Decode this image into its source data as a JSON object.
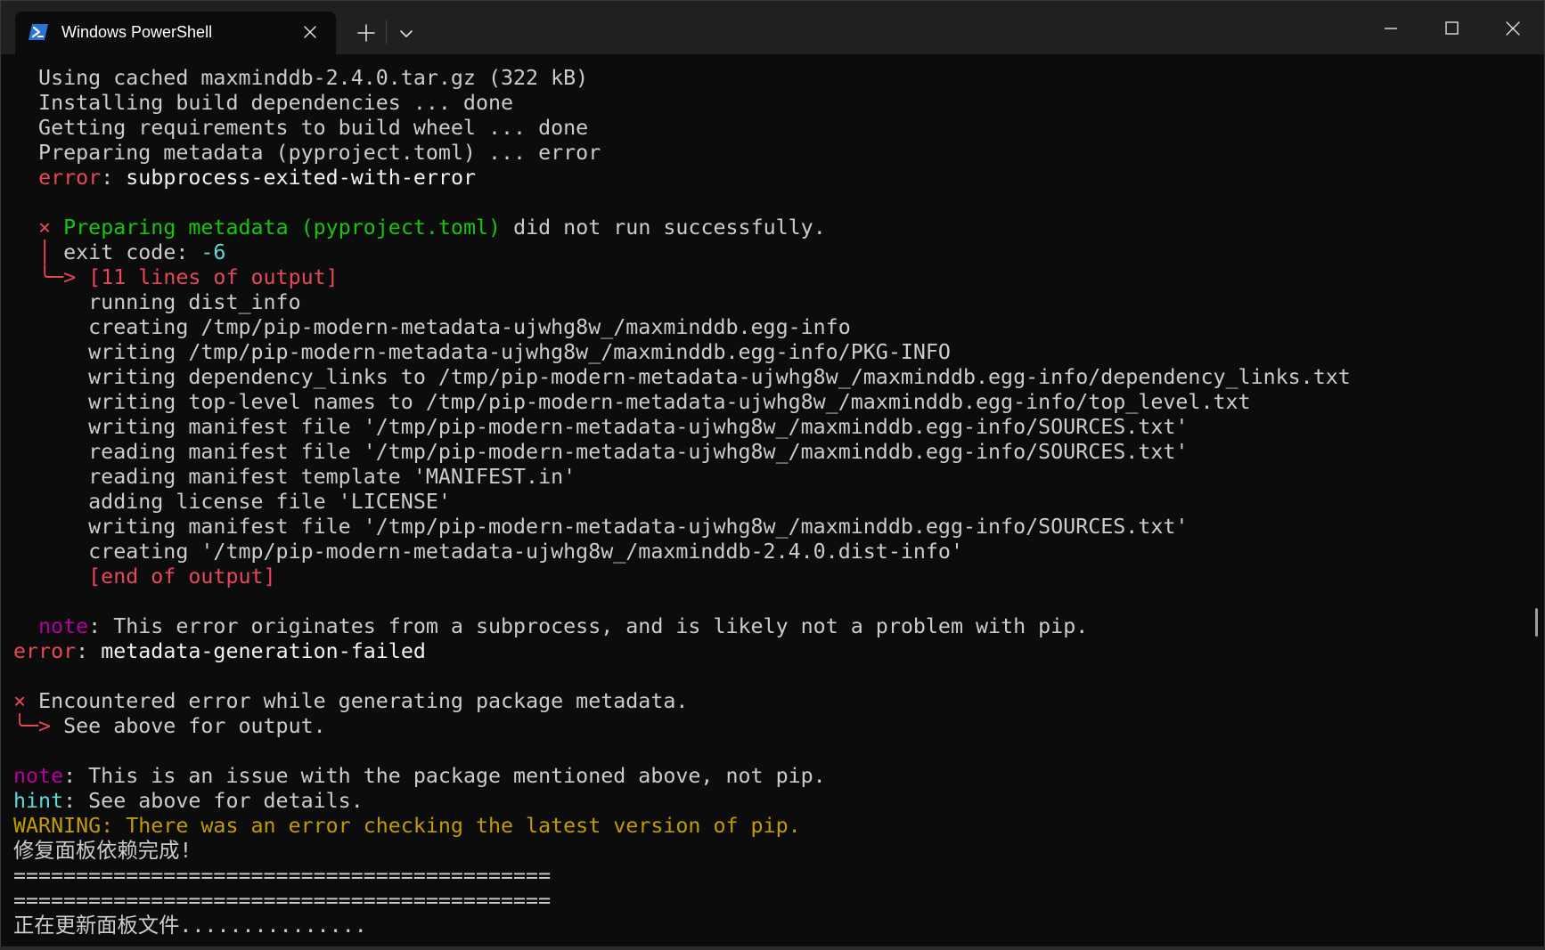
{
  "tab": {
    "title": "Windows PowerShell",
    "icon": "powershell-icon",
    "close_glyph": "✕"
  },
  "toolbar": {
    "new_tab_glyph": "+",
    "dropdown_glyph": "⌄"
  },
  "window_controls": {
    "minimize_glyph": "—",
    "maximize_glyph": "☐",
    "close_glyph": "✕"
  },
  "colors": {
    "background": "#0c0c0c",
    "titlebar": "#202020",
    "foreground": "#cccccc",
    "red": "#e74856",
    "green": "#16c60c",
    "cyan": "#61d6d6",
    "magenta": "#b4009e",
    "yellow": "#c19c00"
  },
  "terminal": {
    "lines": [
      [
        {
          "t": "  Using cached maxminddb-2.4.0.tar.gz (322 kB)"
        }
      ],
      [
        {
          "t": "  Installing build dependencies ... done"
        }
      ],
      [
        {
          "t": "  Getting requirements to build wheel ... done"
        }
      ],
      [
        {
          "t": "  Preparing metadata (pyproject.toml) ... error"
        }
      ],
      [
        {
          "t": "  "
        },
        {
          "t": "error",
          "c": "red"
        },
        {
          "t": ": "
        },
        {
          "t": "subprocess-exited-with-error",
          "c": "white"
        }
      ],
      [
        {
          "t": ""
        }
      ],
      [
        {
          "t": "  "
        },
        {
          "t": "×",
          "c": "red"
        },
        {
          "t": " "
        },
        {
          "t": "Preparing metadata (pyproject.toml)",
          "c": "green"
        },
        {
          "t": " did not run successfully."
        }
      ],
      [
        {
          "t": "  "
        },
        {
          "t": "│",
          "c": "red"
        },
        {
          "t": " exit code: "
        },
        {
          "t": "-6",
          "c": "cyan"
        }
      ],
      [
        {
          "t": "  "
        },
        {
          "t": "╰─>",
          "c": "red"
        },
        {
          "t": " "
        },
        {
          "t": "[11 lines of output]",
          "c": "red"
        }
      ],
      [
        {
          "t": "      running dist_info"
        }
      ],
      [
        {
          "t": "      creating /tmp/pip-modern-metadata-ujwhg8w_/maxminddb.egg-info"
        }
      ],
      [
        {
          "t": "      writing /tmp/pip-modern-metadata-ujwhg8w_/maxminddb.egg-info/PKG-INFO"
        }
      ],
      [
        {
          "t": "      writing dependency_links to /tmp/pip-modern-metadata-ujwhg8w_/maxminddb.egg-info/dependency_links.txt"
        }
      ],
      [
        {
          "t": "      writing top-level names to /tmp/pip-modern-metadata-ujwhg8w_/maxminddb.egg-info/top_level.txt"
        }
      ],
      [
        {
          "t": "      writing manifest file '/tmp/pip-modern-metadata-ujwhg8w_/maxminddb.egg-info/SOURCES.txt'"
        }
      ],
      [
        {
          "t": "      reading manifest file '/tmp/pip-modern-metadata-ujwhg8w_/maxminddb.egg-info/SOURCES.txt'"
        }
      ],
      [
        {
          "t": "      reading manifest template 'MANIFEST.in'"
        }
      ],
      [
        {
          "t": "      adding license file 'LICENSE'"
        }
      ],
      [
        {
          "t": "      writing manifest file '/tmp/pip-modern-metadata-ujwhg8w_/maxminddb.egg-info/SOURCES.txt'"
        }
      ],
      [
        {
          "t": "      creating '/tmp/pip-modern-metadata-ujwhg8w_/maxminddb-2.4.0.dist-info'"
        }
      ],
      [
        {
          "t": "      "
        },
        {
          "t": "[end of output]",
          "c": "red"
        }
      ],
      [
        {
          "t": ""
        }
      ],
      [
        {
          "t": "  "
        },
        {
          "t": "note",
          "c": "magenta"
        },
        {
          "t": ": This error originates from a subprocess, and is likely not a problem with pip."
        }
      ],
      [
        {
          "t": "error",
          "c": "red"
        },
        {
          "t": ": "
        },
        {
          "t": "metadata-generation-failed",
          "c": "white"
        }
      ],
      [
        {
          "t": ""
        }
      ],
      [
        {
          "t": "×",
          "c": "red"
        },
        {
          "t": " Encountered error while generating package metadata."
        }
      ],
      [
        {
          "t": "╰─>",
          "c": "red"
        },
        {
          "t": " See above for output."
        }
      ],
      [
        {
          "t": ""
        }
      ],
      [
        {
          "t": "note",
          "c": "magenta"
        },
        {
          "t": ": This is an issue with the package mentioned above, not pip."
        }
      ],
      [
        {
          "t": "hint",
          "c": "cyan"
        },
        {
          "t": ": See above for details."
        }
      ],
      [
        {
          "t": "WARNING: There was an error checking the latest version of pip.",
          "c": "yellow"
        }
      ],
      [
        {
          "t": "修复面板依赖完成!"
        }
      ],
      [
        {
          "t": "==========================================="
        }
      ],
      [
        {
          "t": "==========================================="
        }
      ],
      [
        {
          "t": "正在更新面板文件..............."
        }
      ]
    ]
  }
}
